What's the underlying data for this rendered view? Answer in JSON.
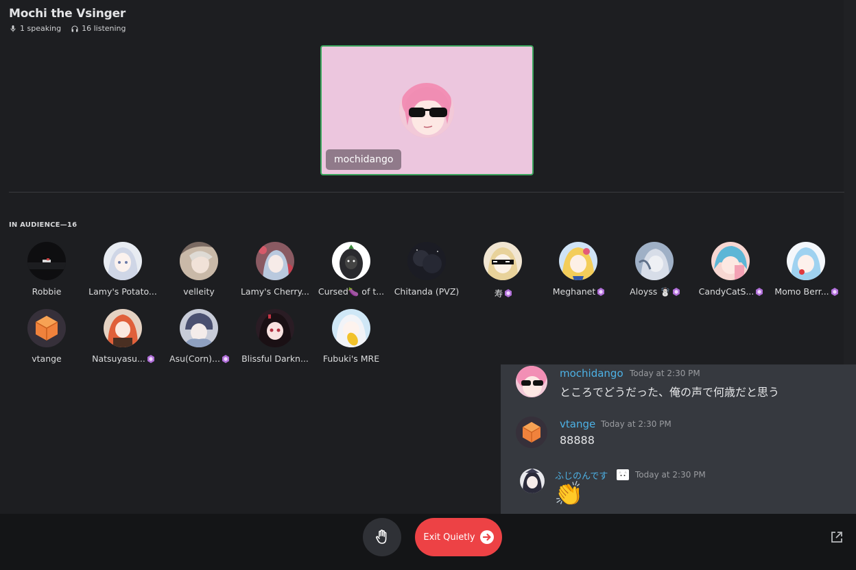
{
  "stage": {
    "title": "Mochi the Vsinger",
    "speaking": "1 speaking",
    "listening": "16 listening"
  },
  "speaker": {
    "name": "mochidango"
  },
  "audience": {
    "header": "IN AUDIENCE—16",
    "members": [
      {
        "name": "Robbie",
        "badge": false
      },
      {
        "name": "Lamy's Potato...",
        "badge": false
      },
      {
        "name": "velleity",
        "badge": false
      },
      {
        "name": "Lamy's Cherry...",
        "badge": false
      },
      {
        "name": "Cursed🍆 of t...",
        "badge": false
      },
      {
        "name": "Chitanda (PVZ)",
        "badge": false
      },
      {
        "name": "寿",
        "badge": true
      },
      {
        "name": "Meghanet",
        "badge": true
      },
      {
        "name": "Aloyss ☃️",
        "badge": true
      },
      {
        "name": "CandyCatS...",
        "badge": true
      },
      {
        "name": "Momo Berr...",
        "badge": true
      },
      {
        "name": "vtange",
        "badge": false
      },
      {
        "name": "Natsuyasu...",
        "badge": true
      },
      {
        "name": "Asu(Corn)...",
        "badge": true
      },
      {
        "name": "Blissful Darkn...",
        "badge": false
      },
      {
        "name": "Fubuki's MRE",
        "badge": false
      }
    ]
  },
  "chat": {
    "messages": [
      {
        "author": "mochidango",
        "time": "Today at 2:30 PM",
        "text": "ところでどうだった、俺の声で何歳だと思う"
      },
      {
        "author": "vtange",
        "time": "Today at 2:30 PM",
        "text": "88888"
      },
      {
        "author": "ふじのんです",
        "time": "Today at 2:30 PM",
        "text": "👏"
      }
    ]
  },
  "controls": {
    "exit_label": "Exit Quietly"
  },
  "colors": {
    "exit": "#ed4245",
    "speaking_border": "#3ba55d",
    "author": "#4db2e6",
    "badge": "#b06fd8"
  }
}
